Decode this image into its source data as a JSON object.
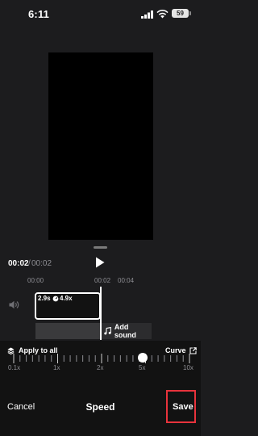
{
  "status_bar": {
    "time": "6:11",
    "battery": "59"
  },
  "playback": {
    "current_time": "00:02",
    "separator": "/",
    "total_time": "00:02"
  },
  "timeline": {
    "ruler": [
      "00:00",
      "00:02",
      "00:04"
    ],
    "clip": {
      "duration": "2.9s",
      "speed": "4.9x"
    },
    "add_sound_label": "Add sound"
  },
  "speed_panel": {
    "apply_all_label": "Apply to all",
    "curve_label": "Curve",
    "scale_labels": [
      "0.1x",
      "1x",
      "2x",
      "5x",
      "10x"
    ],
    "selected_speed": "4.9x",
    "cancel_label": "Cancel",
    "title": "Speed",
    "save_label": "Save"
  },
  "colors": {
    "background": "#1c1c1e",
    "panel": "#121212",
    "highlight": "#e8333c"
  },
  "icons": [
    "signal-icon",
    "wifi-icon",
    "battery-icon",
    "play-icon",
    "volume-icon",
    "speed-icon",
    "music-note-icon",
    "layers-icon",
    "external-link-icon"
  ]
}
